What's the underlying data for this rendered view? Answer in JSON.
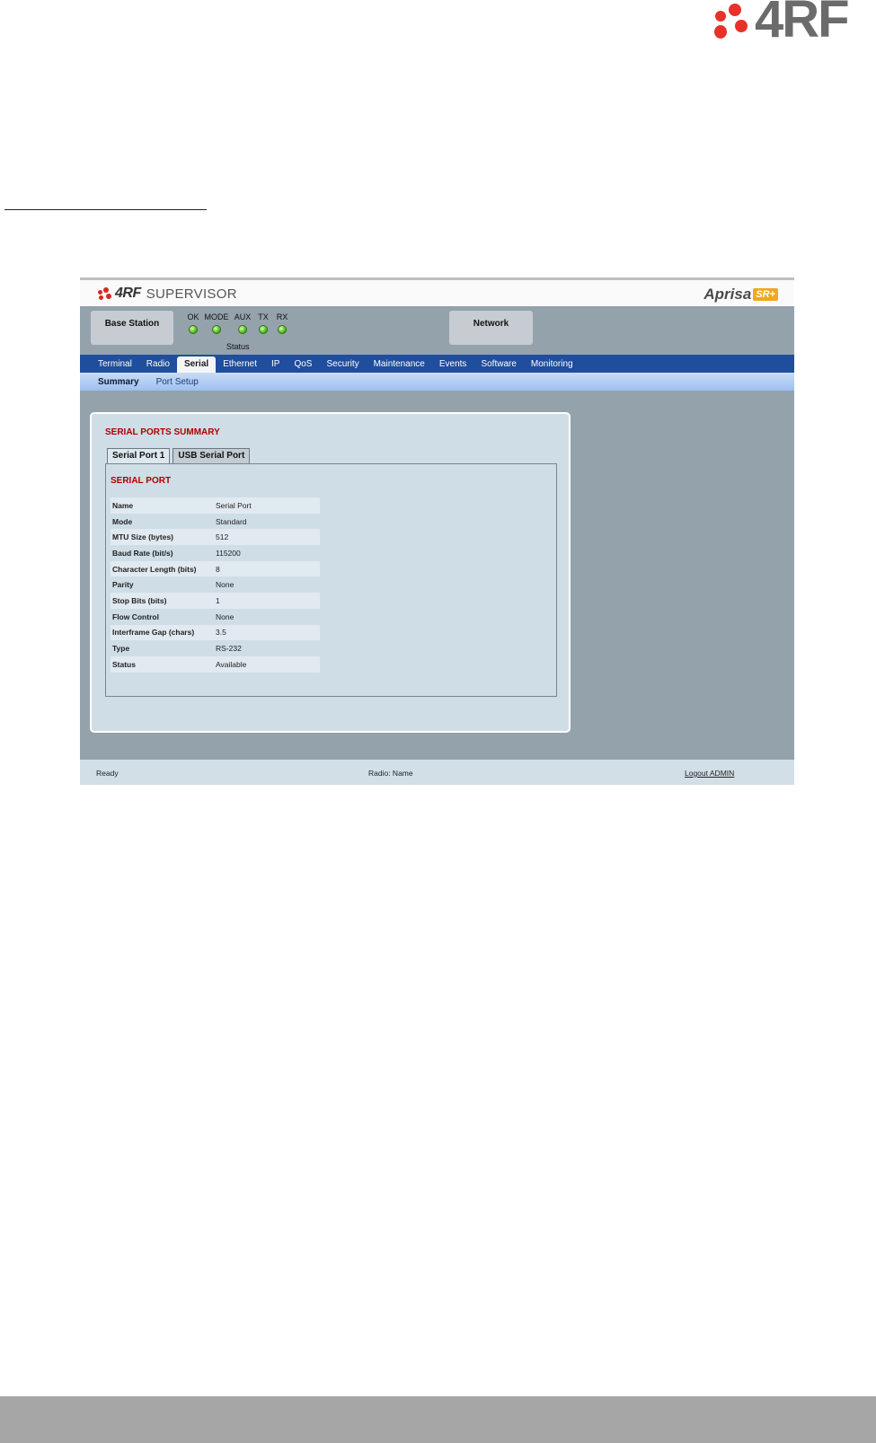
{
  "brand": {
    "logo_text": "4RF"
  },
  "app": {
    "product": {
      "brand": "4RF",
      "name": "SUPERVISOR"
    },
    "aprisa": {
      "name": "Aprisa",
      "badge": "SR+"
    },
    "station_box": "Base Station",
    "network_box": "Network",
    "leds": [
      {
        "label": "OK",
        "color": "#4cc21b"
      },
      {
        "label": "MODE",
        "color": "#4cc21b"
      },
      {
        "label": "AUX",
        "color": "#4cc21b"
      },
      {
        "label": "TX",
        "color": "#4cc21b"
      },
      {
        "label": "RX",
        "color": "#4cc21b"
      }
    ],
    "status_label": "Status",
    "nav": [
      "Terminal",
      "Radio",
      "Serial",
      "Ethernet",
      "IP",
      "QoS",
      "Security",
      "Maintenance",
      "Events",
      "Software",
      "Monitoring"
    ],
    "nav_active": "Serial",
    "subnav": [
      "Summary",
      "Port Setup"
    ],
    "subnav_active": "Summary",
    "panel": {
      "title": "SERIAL PORTS SUMMARY",
      "tabs": [
        "Serial Port 1",
        "USB Serial Port"
      ],
      "active_tab": "Serial Port 1",
      "section_title": "SERIAL PORT",
      "rows": [
        {
          "key": "Name",
          "value": "Serial Port"
        },
        {
          "key": "Mode",
          "value": "Standard"
        },
        {
          "key": "MTU Size (bytes)",
          "value": "512"
        },
        {
          "key": "Baud Rate (bit/s)",
          "value": "115200"
        },
        {
          "key": "Character Length (bits)",
          "value": "8"
        },
        {
          "key": "Parity",
          "value": "None"
        },
        {
          "key": "Stop Bits (bits)",
          "value": "1"
        },
        {
          "key": "Flow Control",
          "value": "None"
        },
        {
          "key": "Interframe Gap (chars)",
          "value": "3.5"
        },
        {
          "key": "Type",
          "value": "RS-232"
        },
        {
          "key": "Status",
          "value": "Available"
        }
      ]
    },
    "statusbar": {
      "left": "Ready",
      "middle": "Radio: Name",
      "logout": "Logout ADMIN"
    }
  }
}
